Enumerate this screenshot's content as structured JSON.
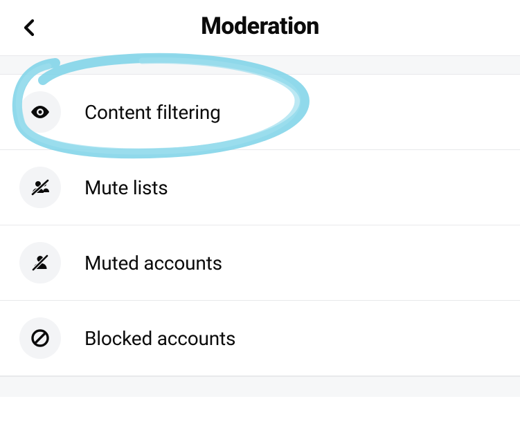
{
  "header": {
    "title": "Moderation"
  },
  "menu": {
    "items": [
      {
        "label": "Content filtering",
        "icon": "eye-icon",
        "highlighted": true
      },
      {
        "label": "Mute lists",
        "icon": "users-slash-icon",
        "highlighted": false
      },
      {
        "label": "Muted accounts",
        "icon": "user-slash-icon",
        "highlighted": false
      },
      {
        "label": "Blocked accounts",
        "icon": "block-icon",
        "highlighted": false
      }
    ]
  },
  "highlight": {
    "color": "#7dd3e8"
  }
}
